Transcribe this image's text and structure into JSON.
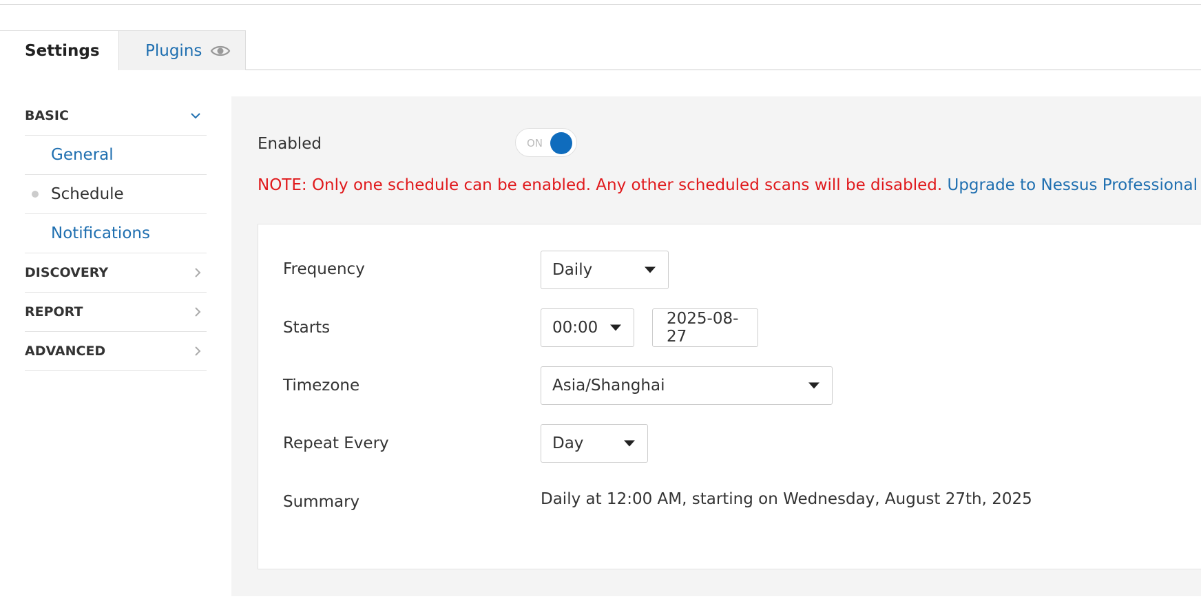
{
  "tabs": {
    "settings": "Settings",
    "plugins": "Plugins"
  },
  "sidebar": {
    "basic": "BASIC",
    "basic_items": [
      "General",
      "Schedule",
      "Notifications"
    ],
    "active_item": "Schedule",
    "discovery": "DISCOVERY",
    "report": "REPORT",
    "advanced": "ADVANCED"
  },
  "schedule": {
    "enabled_label": "Enabled",
    "toggle_text": "ON",
    "toggle_state": "on",
    "note": "NOTE: Only one schedule can be enabled. Any other scheduled scans will be disabled.",
    "upgrade_link": "Upgrade to Nessus Professional",
    "frequency_label": "Frequency",
    "frequency_value": "Daily",
    "starts_label": "Starts",
    "start_time": "00:00",
    "start_date": "2025-08-27",
    "timezone_label": "Timezone",
    "timezone_value": "Asia/Shanghai",
    "repeat_label": "Repeat Every",
    "repeat_value": "Day",
    "summary_label": "Summary",
    "summary_text": "Daily at 12:00 AM, starting on Wednesday, August 27th, 2025"
  },
  "icons": {
    "plugins_tab": "eye-icon",
    "basic_chevron": "chevron-down-icon",
    "section_chevron": "chevron-right-icon",
    "dropdown": "caret-down-icon"
  },
  "colors": {
    "link": "#1f6fb0",
    "note": "#e0191c",
    "toggle_on": "#0f6cbd",
    "panel_bg": "#f4f4f4"
  }
}
